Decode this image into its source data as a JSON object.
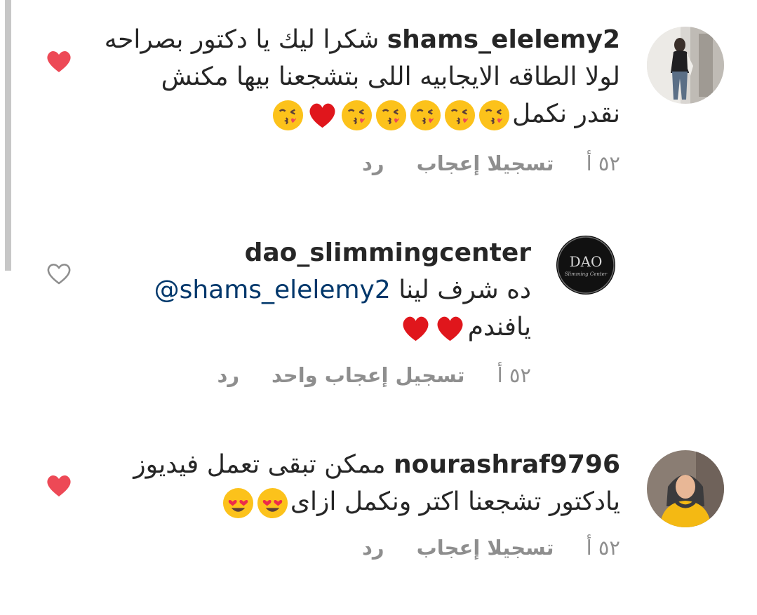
{
  "comments": [
    {
      "username": "shams_elelemy2",
      "line1": "شكرا ليك يا دكتور  بصراحه",
      "line2": "لولا الطاقه الايجابيه اللى بتشجعنا بيها مكنش",
      "line3": "نقدر نكمل",
      "time": "٥٢ أ",
      "likes": "تسجيلا إعجاب",
      "reply": "رد",
      "liked": true
    },
    {
      "username": "dao_slimmingcenter",
      "line1": "ده شرف لينا",
      "mention": "@shams_elelemy2",
      "line2": "يافندم",
      "time": "٥٢ أ",
      "likes": "تسجيل إعجاب واحد",
      "reply": "رد",
      "avatar_logo": "DAO",
      "avatar_subtitle": "Slimming Center",
      "liked": false
    },
    {
      "username": "nourashraf9796",
      "line1": "ممكن تبقى تعمل فيديوز",
      "line2": "يادكتور تشجعنا اكتر ونكمل ازاى",
      "time": "٥٢ أ",
      "likes": "تسجيلا إعجاب",
      "reply": "رد",
      "liked": true
    }
  ],
  "colors": {
    "text": "#262626",
    "secondary": "#8e8e8e",
    "mention": "#00376b",
    "heart_liked": "#ed4956",
    "heart_unliked": "#8e8e8e"
  },
  "icons": {
    "like_filled": "heart-filled-icon",
    "like_outline": "heart-outline-icon",
    "kiss_emoji": "face-blowing-kiss-emoji",
    "heart_emoji": "red-heart-emoji",
    "heart_eyes_emoji": "heart-eyes-emoji"
  }
}
